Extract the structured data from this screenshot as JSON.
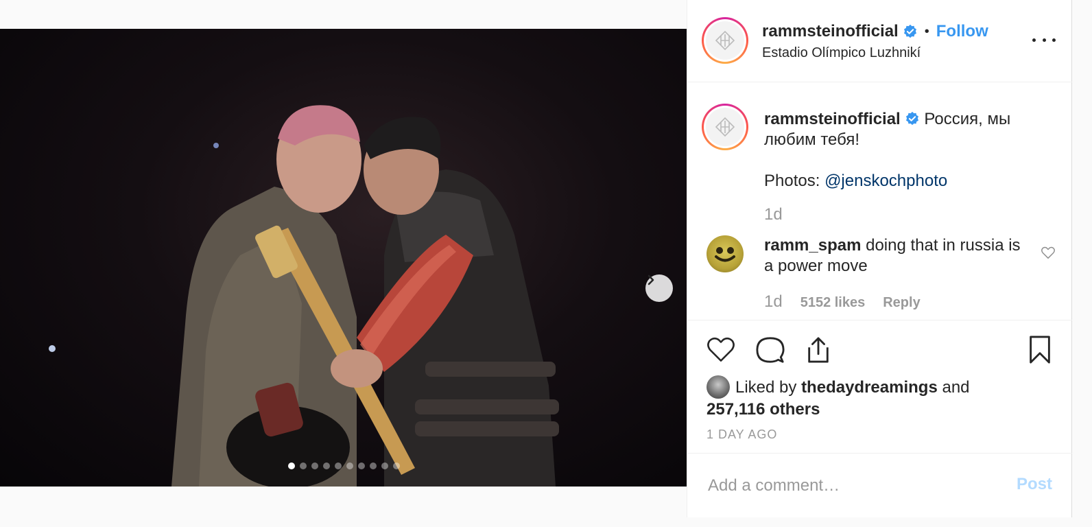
{
  "post": {
    "username": "rammsteinofficial",
    "verified": true,
    "follow_label": "Follow",
    "bullet": "•",
    "location": "Estadio Olímpico Luzhnikí",
    "more_icon": "more-options-icon",
    "carousel": {
      "total": 10,
      "current": 1,
      "next_icon": "chevron-right-icon"
    }
  },
  "caption": {
    "username": "rammsteinofficial",
    "text": "Россия, мы любим тебя!",
    "photos_label": "Photos: ",
    "mention": "@jenskochphoto",
    "age": "1d"
  },
  "comment": {
    "username": "ramm_spam",
    "text": "doing that in russia is a power move",
    "age": "1d",
    "likes": "5152 likes",
    "reply_label": "Reply"
  },
  "actions": {
    "like_icon": "heart-icon",
    "comment_icon": "comment-icon",
    "share_icon": "share-icon",
    "save_icon": "bookmark-icon",
    "liked_by_prefix": "Liked by",
    "liked_by_user": "thedaydreamings",
    "liked_by_and": "and",
    "liked_by_others": "257,116 others",
    "time_ago": "1 DAY AGO"
  },
  "add_comment": {
    "placeholder": "Add a comment…",
    "post_label": "Post"
  },
  "colors": {
    "accent": "#3897f0",
    "mention": "#003569",
    "muted": "#999999",
    "post_disabled": "#b3dbff"
  }
}
